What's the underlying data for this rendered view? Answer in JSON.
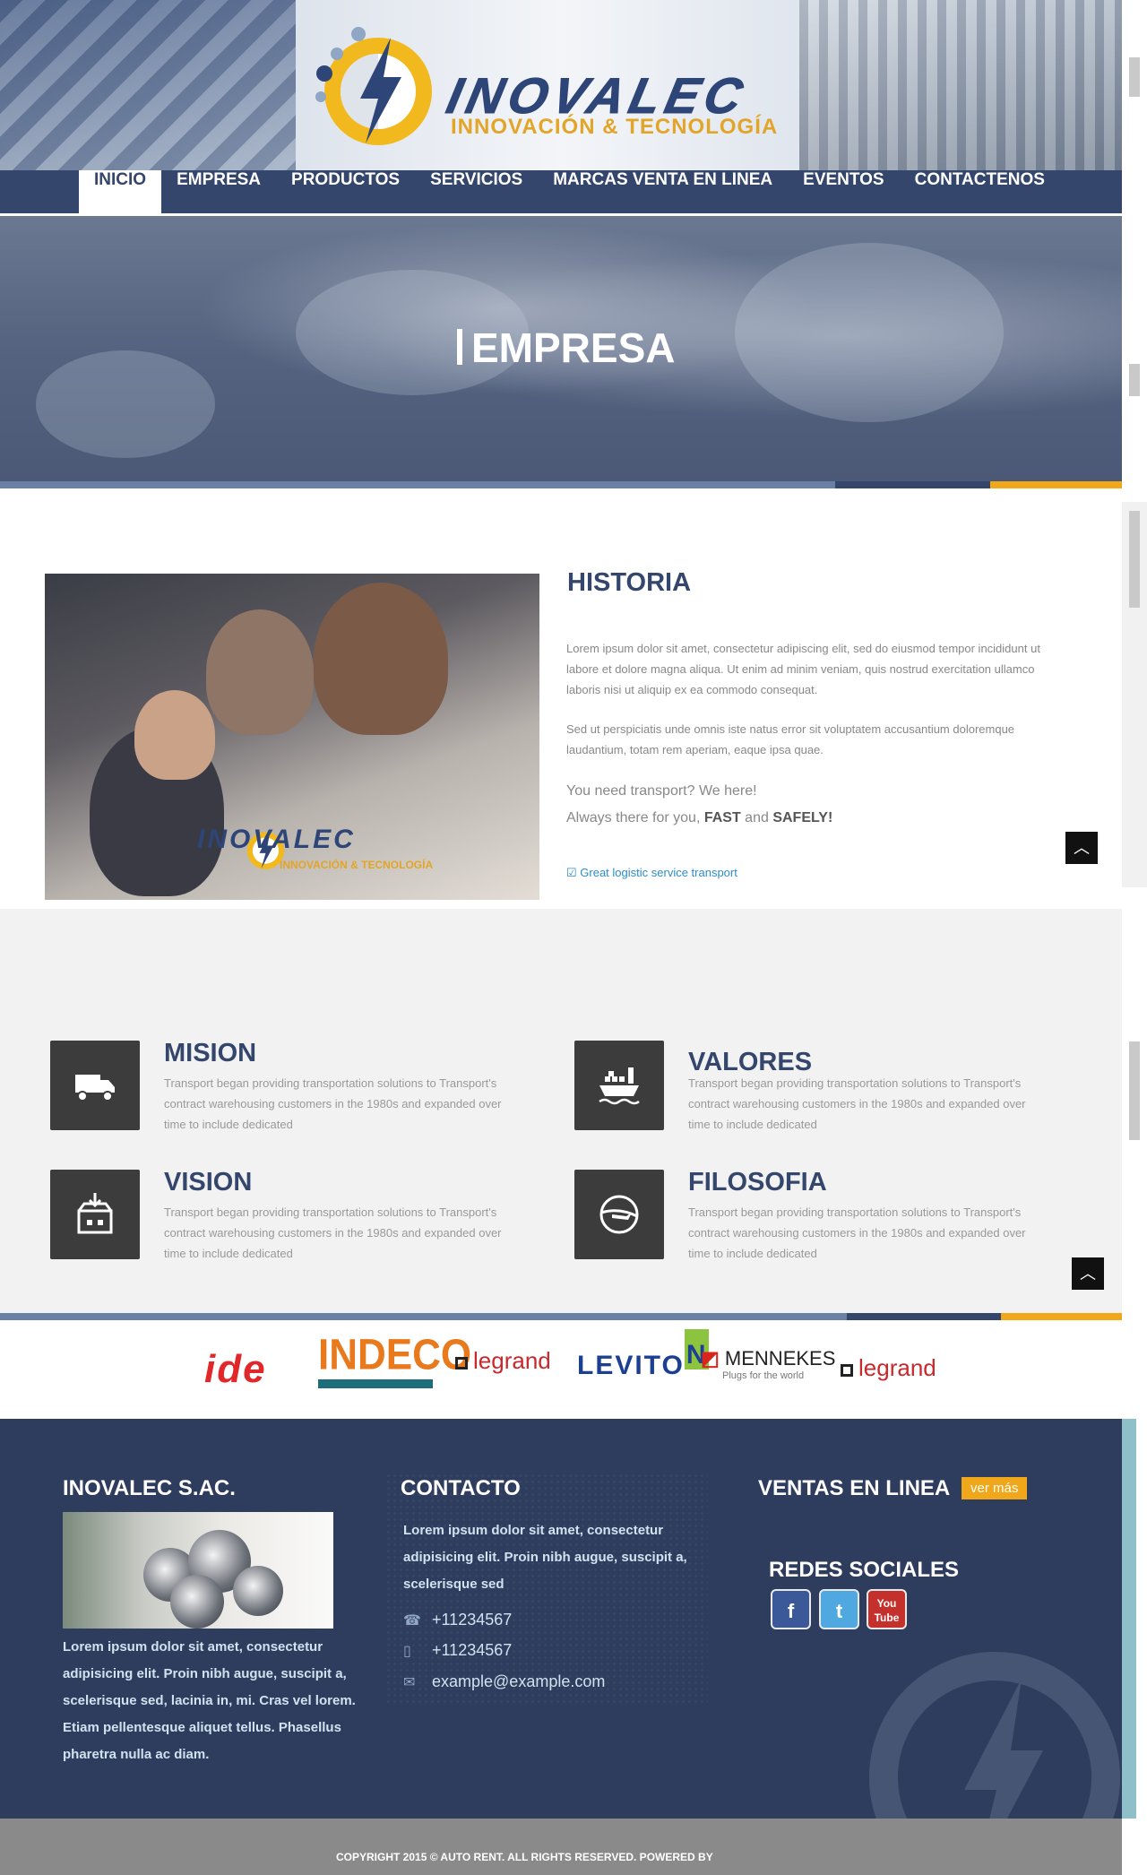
{
  "header": {
    "logo_name": "INOVALEC",
    "logo_tagline": "INNOVACIÓN & TECNOLOGÍA"
  },
  "nav": {
    "items": [
      {
        "label": "INICIO",
        "active": true
      },
      {
        "label": "EMPRESA",
        "active": false
      },
      {
        "label": "PRODUCTOS",
        "active": false
      },
      {
        "label": "SERVICIOS",
        "active": false
      },
      {
        "label": "MARCAS VENTA EN LINEA",
        "active": false
      },
      {
        "label": "EVENTOS",
        "active": false
      },
      {
        "label": "CONTACTENOS",
        "active": false
      }
    ]
  },
  "hero": {
    "title": "EMPRESA"
  },
  "historia": {
    "title": "HISTORIA",
    "p1": "Lorem ipsum dolor sit amet, consectetur adipiscing elit, sed do eiusmod tempor incididunt ut labore et dolore magna aliqua. Ut enim ad minim veniam, quis nostrud exercitation ullamco laboris nisi ut aliquip ex ea commodo consequat.",
    "p2": "Sed ut perspiciatis unde omnis iste natus error sit voluptatem accusantium doloremque laudantium, totam rem aperiam, eaque ipsa quae.",
    "q1": "You need transport? We here!",
    "q2_pre": "Always there for you, ",
    "q2_fast": "FAST",
    "q2_and": " and ",
    "q2_safely": "SAFELY!",
    "link": "Great logistic service transport",
    "image_watermark": "INOVALEC",
    "image_watermark_tag": "INNOVACIÓN & TECNOLOGÍA"
  },
  "features": [
    {
      "title": "MISION",
      "icon": "truck-icon",
      "text": "Transport began providing transportation solutions to Transport's contract warehousing customers in the 1980s and expanded over time to include dedicated"
    },
    {
      "title": "VALORES",
      "icon": "ship-icon",
      "text": "Transport began providing transportation solutions to Transport's contract warehousing customers in the 1980s and expanded over time to include dedicated"
    },
    {
      "title": "VISION",
      "icon": "package-icon",
      "text": "Transport began providing transportation solutions to Transport's contract warehousing customers in the 1980s and expanded over time to include dedicated"
    },
    {
      "title": "FILOSOFIA",
      "icon": "plane-globe-icon",
      "text": "Transport began providing transportation solutions to Transport's contract warehousing customers in the 1980s and expanded over time to include dedicated"
    }
  ],
  "brands": {
    "b1": "ide",
    "b2": "INDECO",
    "b3": "legrand",
    "b4_a": "LEVITO",
    "b4_b": "N",
    "b5": "MENNEKES",
    "b5_tag": "Plugs for the world",
    "b6": "legrand"
  },
  "footer": {
    "company_title": "INOVALEC S.AC.",
    "company_text": "Lorem ipsum dolor sit amet, consectetur adipisicing elit. Proin nibh augue, suscipit a, scelerisque sed, lacinia in, mi. Cras vel lorem. Etiam pellentesque aliquet tellus. Phasellus pharetra nulla ac diam.",
    "contact_title": "CONTACTO",
    "contact_text": "Lorem ipsum dolor sit amet, consectetur adipisicing elit. Proin nibh augue, suscipit a, scelerisque sed",
    "phone": "+11234567",
    "mobile": "+11234567",
    "email": "example@example.com",
    "ventas_title": "VENTAS EN LINEA",
    "ver_mas": "ver más",
    "redes_title": "REDES SOCIALES",
    "youtube_top": "You",
    "youtube_bottom": "Tube"
  },
  "copyright": "COPYRIGHT 2015 © AUTO RENT. ALL RIGHTS RESERVED.  POWERED BY",
  "colors": {
    "navy": "#34466c",
    "footer_bg": "#2e3c5e",
    "accent_orange": "#f0a81a",
    "stripe_blue": "#6a80a6",
    "link_blue": "#2b8dc9"
  }
}
